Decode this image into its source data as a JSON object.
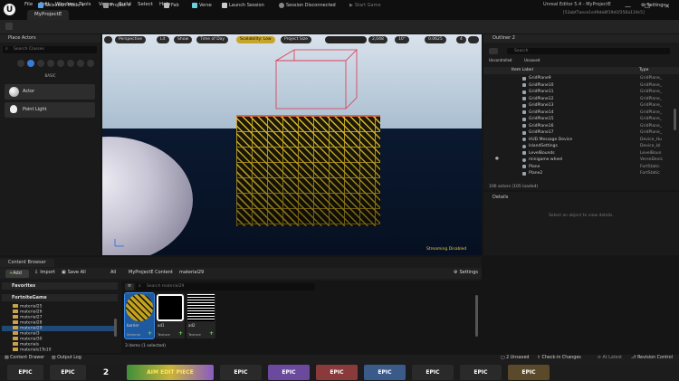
{
  "titlebar": {
    "app_logo": "U",
    "menus": [
      "File",
      "Edit",
      "Window",
      "Tools",
      "Verse",
      "Build",
      "Select",
      "Help"
    ],
    "project_tab": "MyProjectE",
    "window_title": "Unreal Editor 5.4 - MyProjectE",
    "window_id": "[53abf7aece1e49de8f19d1f256a119c5]",
    "minimize": "—",
    "maximize": "☐",
    "close": "✕"
  },
  "toolbar": {
    "selection_mode": "Selection Mode",
    "project": "Project",
    "fab": "Fab",
    "verse": "Verse",
    "launch_session": "Launch Session",
    "session_status": "Session Disconnected",
    "start_game": "Start Game",
    "settings": "Settings"
  },
  "place_actors": {
    "tab": "Place Actors",
    "search_placeholder": "Search Classes",
    "category": "BASIC",
    "items": [
      {
        "label": "Actor",
        "icon": "sphere-icon"
      },
      {
        "label": "Point Light",
        "icon": "light-bulb-icon"
      }
    ]
  },
  "viewport": {
    "perspective": "Perspective",
    "lit": "Lit",
    "show": "Show",
    "time_of_day": "Time of Day",
    "scalability": "Scalability: Low",
    "project_size": "Project Size",
    "grid_snap": "2,048",
    "rotation_snap": "10°",
    "scale_snap": "0.0625",
    "camera_speed": "4",
    "streaming": "Streaming Disabled",
    "colors": {
      "scalability_bg": "#c7a52a",
      "wall_pattern": "#e0c02e",
      "selection_box": "#e0344a"
    }
  },
  "outliner": {
    "tab": "Outliner 2",
    "search_placeholder": "Search",
    "tabs": [
      "Uncontrolled",
      "Unsaved"
    ],
    "col_label": "Item Label",
    "col_type": "Type",
    "rows": [
      {
        "name": "GridPlane9",
        "type": "GridPlane_"
      },
      {
        "name": "GridPlane10",
        "type": "GridPlane_"
      },
      {
        "name": "GridPlane11",
        "type": "GridPlane_"
      },
      {
        "name": "GridPlane12",
        "type": "GridPlane_"
      },
      {
        "name": "GridPlane13",
        "type": "GridPlane_"
      },
      {
        "name": "GridPlane14",
        "type": "GridPlane_"
      },
      {
        "name": "GridPlane15",
        "type": "GridPlane_"
      },
      {
        "name": "GridPlane16",
        "type": "GridPlane_"
      },
      {
        "name": "GridPlane17",
        "type": "GridPlane_"
      },
      {
        "name": "HUD Message Device",
        "type": "Device_Hu"
      },
      {
        "name": "IslandSettings",
        "type": "Device_Isl"
      },
      {
        "name": "LevelBounds",
        "type": "LevelBoun"
      },
      {
        "name": "minigame wheel",
        "type": "VerseDevic"
      },
      {
        "name": "Plane",
        "type": "FortStatic"
      },
      {
        "name": "Plane2",
        "type": "FortStatic"
      }
    ],
    "status": "106 actors (105 loaded)"
  },
  "details": {
    "tab": "Details",
    "empty_message": "Select an object to view details."
  },
  "content_browser": {
    "tab": "Content Browser",
    "add": "Add",
    "import": "Import",
    "save_all": "Save All",
    "path": [
      "All",
      "MyProjectE Content",
      "material29"
    ],
    "settings": "Settings",
    "favorites": "Favorites",
    "root": "FortniteGame",
    "folders": [
      "material25",
      "material26",
      "material27",
      "material28",
      "material29",
      "material3",
      "material30",
      "materials",
      "materials1To10"
    ],
    "selected_folder": "material29",
    "search_placeholder": "Search material29",
    "assets": [
      {
        "name": "barrier",
        "type": "Material"
      },
      {
        "name": "ad1",
        "type": "Texture"
      },
      {
        "name": "ad2",
        "type": "Texture"
      }
    ],
    "item_count": "3 items (1 selected)"
  },
  "statusbar": {
    "content_drawer": "Content Drawer",
    "output_log": "Output Log",
    "unsaved": "2 Unsaved",
    "check_in": "Check-in Changes",
    "at_latest": "At Latest",
    "revision_control": "Revision Control"
  },
  "taskbar": {
    "tiles": [
      "EPIC",
      "EPIC",
      "2",
      "AIM EDIT PIECE",
      "EPIC",
      "EPIC",
      "EPIC",
      "EPIC",
      "EPIC",
      "EPIC",
      "EPIC"
    ]
  }
}
